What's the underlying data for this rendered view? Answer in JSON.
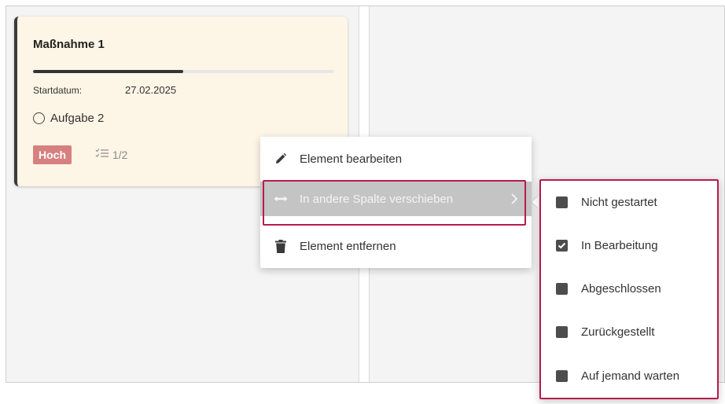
{
  "card": {
    "title": "Maßnahme 1",
    "progress": 0.5,
    "start_label": "Startdatum:",
    "start_date": "27.02.2025",
    "task_label": "Aufgabe 2",
    "priority": "Hoch",
    "checklist_count": "1/2"
  },
  "context_menu": {
    "edit_label": "Element bearbeiten",
    "move_label": "In andere Spalte verschieben",
    "remove_label": "Element entfernen"
  },
  "submenu": {
    "items": [
      {
        "label": "Nicht gestartet",
        "checked": false
      },
      {
        "label": "In Bearbeitung",
        "checked": true
      },
      {
        "label": "Abgeschlossen",
        "checked": false
      },
      {
        "label": "Zurückgestellt",
        "checked": false
      },
      {
        "label": "Auf jemand warten",
        "checked": false
      }
    ]
  },
  "colors": {
    "card_bg": "#fdf5e6",
    "priority_badge": "#d68080",
    "highlight_outline": "#b71c4a",
    "menu_hover": "#c4c4c4"
  },
  "icons": {
    "edit": "pencil-icon",
    "move": "arrows-horizontal-icon",
    "remove": "trash-icon",
    "checklist": "checklist-icon",
    "submenu_chevron": "chevron-right-icon"
  }
}
